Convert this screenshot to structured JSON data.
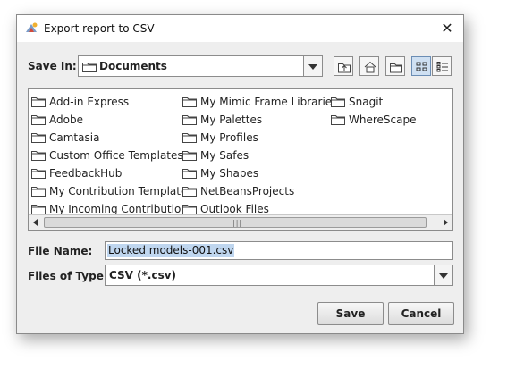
{
  "window": {
    "title": "Export report to CSV",
    "close_symbol": "✕",
    "icon": "app-logo-icon"
  },
  "save_in": {
    "label_prefix": "Save ",
    "label_mnemonic": "I",
    "label_suffix": "n:",
    "value": "Documents"
  },
  "toolbar": {
    "icons": [
      "up-one-level-icon",
      "home-icon",
      "new-folder-icon",
      "list-view-icon",
      "details-view-icon"
    ]
  },
  "files": {
    "column1": [
      "Add-in Express",
      "Adobe",
      "Camtasia",
      "Custom Office Templates",
      "FeedbackHub",
      "My Contribution Templates",
      "My Incoming Contributions"
    ],
    "column2": [
      "My Mimic Frame Libraries",
      "My Palettes",
      "My Profiles",
      "My Safes",
      "My Shapes",
      "NetBeansProjects",
      "Outlook Files"
    ],
    "column3": [
      "Snagit",
      "WhereScape"
    ]
  },
  "file_name": {
    "label_prefix": "File ",
    "label_mnemonic": "N",
    "label_suffix": "ame:",
    "value": "Locked models-001.csv"
  },
  "file_type": {
    "label_prefix": "Files of ",
    "label_mnemonic": "T",
    "label_suffix": "ype:",
    "value": "CSV (*.csv)"
  },
  "buttons": {
    "save": "Save",
    "cancel": "Cancel"
  },
  "scrollbar": {
    "grip": "|||"
  }
}
